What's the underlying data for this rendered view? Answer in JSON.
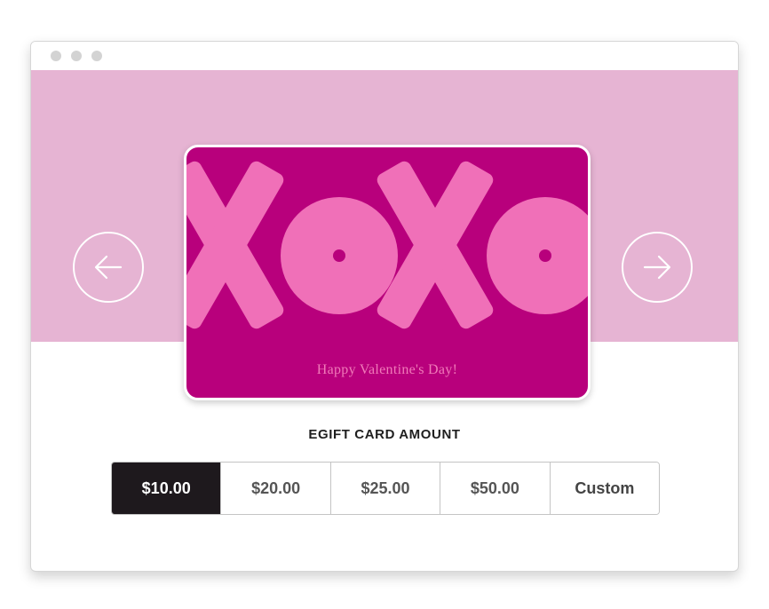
{
  "window": {
    "controls": [
      "window-dot",
      "window-dot",
      "window-dot"
    ]
  },
  "carousel": {
    "prev_icon": "arrow-left-icon",
    "next_icon": "arrow-right-icon",
    "banner_color": "#e6b4d3"
  },
  "gift_card": {
    "artwork_text": "XOXO",
    "message": "Happy Valentine's Day!",
    "background_color": "#b8007c",
    "artwork_color": "#f070b8"
  },
  "amount": {
    "label": "EGIFT CARD AMOUNT",
    "options": [
      "$10.00",
      "$20.00",
      "$25.00",
      "$50.00",
      "Custom"
    ],
    "selected": "$10.00"
  }
}
